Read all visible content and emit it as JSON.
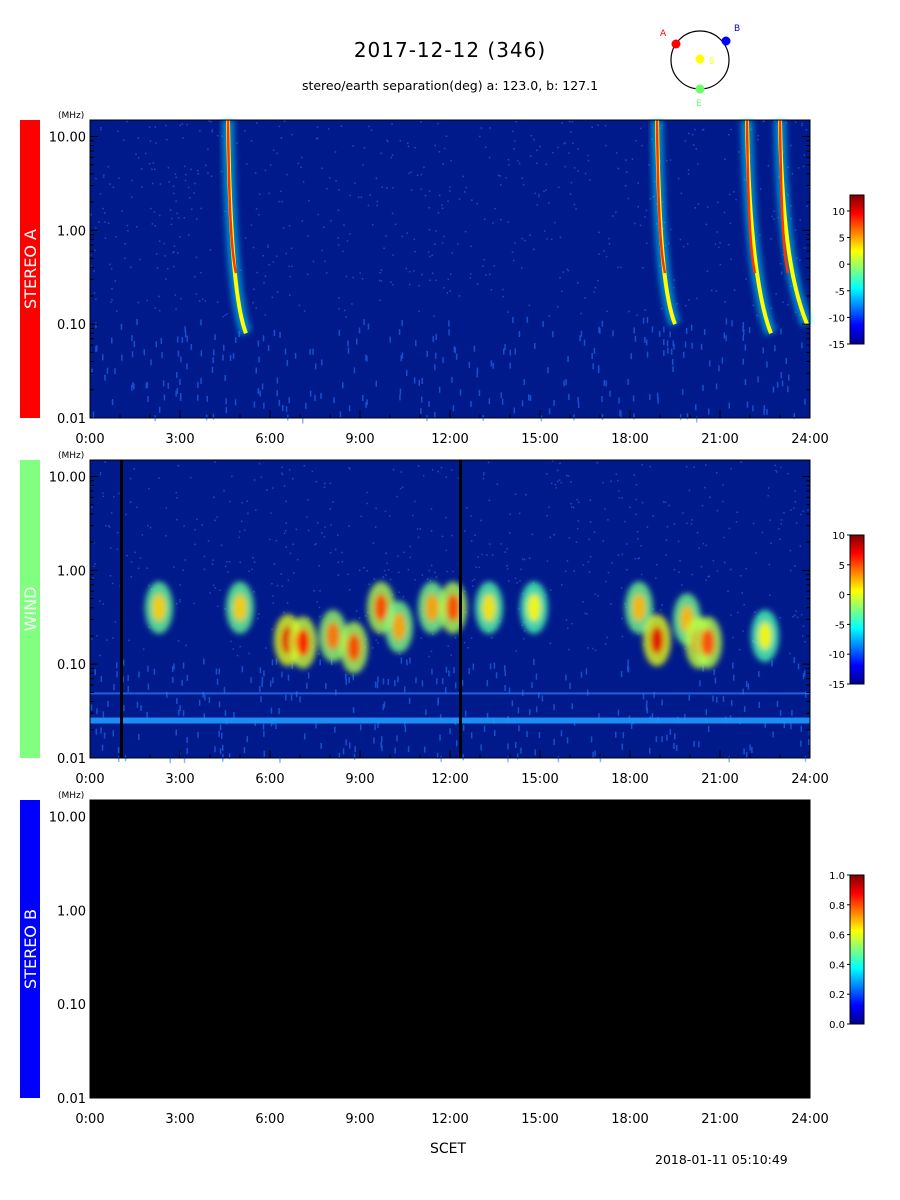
{
  "header": {
    "title": "2017-12-12 (346)",
    "subtitle": "stereo/earth separation(deg) a: 123.0, b: 127.1",
    "generated": "2018-01-11 05:10:49",
    "xaxis_title": "SCET"
  },
  "orbit": {
    "labels": {
      "a": "A",
      "b": "B",
      "sun": "S",
      "earth": "E"
    },
    "colors": {
      "a": "#ff0000",
      "b": "#0000ff",
      "sun": "#ffff00",
      "earth": "#66ff66"
    }
  },
  "colors": {
    "stereo_a": "#ff0000",
    "wind": "#80ff80",
    "stereo_b": "#0000ff",
    "background": "#001a8c",
    "empty_panel": "#000000"
  },
  "chart_data": [
    {
      "type": "heatmap",
      "label": "STEREO A",
      "yunit": "(MHz)",
      "y_scale": "log",
      "ylim": [
        0.01,
        15
      ],
      "y_ticks": [
        "10.00",
        "1.00",
        "0.10",
        "0.01"
      ],
      "y_tick_values": [
        10,
        1,
        0.1,
        0.01
      ],
      "x_ticks": [
        "0:00",
        "3:00",
        "6:00",
        "9:00",
        "12:00",
        "15:00",
        "18:00",
        "21:00",
        "24:00"
      ],
      "x_tick_values": [
        0,
        3,
        6,
        9,
        12,
        15,
        18,
        21,
        24
      ],
      "xlim": [
        0,
        24
      ],
      "colorbar": {
        "ticks": [
          "10",
          "5",
          "0",
          "-5",
          "-10",
          "-15"
        ],
        "values": [
          10,
          5,
          0,
          -5,
          -10,
          -15
        ],
        "range": [
          -15,
          13
        ]
      },
      "bursts": [
        {
          "start_hour": 4.6,
          "end_hour": 5.2,
          "f_high_mhz": 15,
          "f_low_mhz": 0.08
        },
        {
          "start_hour": 18.9,
          "end_hour": 19.5,
          "f_high_mhz": 15,
          "f_low_mhz": 0.1
        },
        {
          "start_hour": 21.9,
          "end_hour": 22.7,
          "f_high_mhz": 15,
          "f_low_mhz": 0.08
        },
        {
          "start_hour": 23.0,
          "end_hour": 23.9,
          "f_high_mhz": 15,
          "f_low_mhz": 0.1
        }
      ]
    },
    {
      "type": "heatmap",
      "label": "WIND",
      "yunit": "(MHz)",
      "y_scale": "log",
      "ylim": [
        0.01,
        15
      ],
      "y_ticks": [
        "10.00",
        "1.00",
        "0.10",
        "0.01"
      ],
      "y_tick_values": [
        10,
        1,
        0.1,
        0.01
      ],
      "x_ticks": [
        "0:00",
        "3:00",
        "6:00",
        "9:00",
        "12:00",
        "15:00",
        "18:00",
        "21:00",
        "24:00"
      ],
      "x_tick_values": [
        0,
        3,
        6,
        9,
        12,
        15,
        18,
        21,
        24
      ],
      "xlim": [
        0,
        24
      ],
      "colorbar": {
        "ticks": [
          "10",
          "5",
          "0",
          "-5",
          "-10",
          "-15"
        ],
        "values": [
          10,
          5,
          0,
          -5,
          -10,
          -15
        ],
        "range": [
          -15,
          10
        ]
      },
      "emission_patches": [
        {
          "hour": 2.3,
          "f_mhz": 0.4,
          "intensity": 0.5
        },
        {
          "hour": 5.0,
          "f_mhz": 0.4,
          "intensity": 0.5
        },
        {
          "hour": 6.6,
          "f_mhz": 0.18,
          "intensity": 1.0
        },
        {
          "hour": 7.1,
          "f_mhz": 0.17,
          "intensity": 0.9
        },
        {
          "hour": 8.1,
          "f_mhz": 0.2,
          "intensity": 0.7
        },
        {
          "hour": 8.8,
          "f_mhz": 0.15,
          "intensity": 0.8
        },
        {
          "hour": 9.7,
          "f_mhz": 0.4,
          "intensity": 0.8
        },
        {
          "hour": 10.3,
          "f_mhz": 0.25,
          "intensity": 0.6
        },
        {
          "hour": 11.4,
          "f_mhz": 0.4,
          "intensity": 0.6
        },
        {
          "hour": 12.1,
          "f_mhz": 0.4,
          "intensity": 0.8
        },
        {
          "hour": 13.3,
          "f_mhz": 0.4,
          "intensity": 0.45
        },
        {
          "hour": 14.8,
          "f_mhz": 0.4,
          "intensity": 0.4
        },
        {
          "hour": 18.3,
          "f_mhz": 0.4,
          "intensity": 0.55
        },
        {
          "hour": 18.9,
          "f_mhz": 0.18,
          "intensity": 1.0
        },
        {
          "hour": 19.9,
          "f_mhz": 0.3,
          "intensity": 0.55
        },
        {
          "hour": 20.3,
          "f_mhz": 0.17,
          "intensity": 0.85
        },
        {
          "hour": 20.6,
          "f_mhz": 0.17,
          "intensity": 0.8
        },
        {
          "hour": 22.5,
          "f_mhz": 0.2,
          "intensity": 0.4
        }
      ],
      "data_gaps_hours": [
        1.0,
        12.3
      ]
    },
    {
      "type": "heatmap",
      "label": "STEREO B",
      "yunit": "(MHz)",
      "y_scale": "log",
      "ylim": [
        0.01,
        15
      ],
      "y_ticks": [
        "10.00",
        "1.00",
        "0.10",
        "0.01"
      ],
      "y_tick_values": [
        10,
        1,
        0.1,
        0.01
      ],
      "x_ticks": [
        "0:00",
        "3:00",
        "6:00",
        "9:00",
        "12:00",
        "15:00",
        "18:00",
        "21:00",
        "24:00"
      ],
      "x_tick_values": [
        0,
        3,
        6,
        9,
        12,
        15,
        18,
        21,
        24
      ],
      "xlim": [
        0,
        24
      ],
      "no_data": true,
      "colorbar": {
        "ticks": [
          "1.0",
          "0.8",
          "0.6",
          "0.4",
          "0.2",
          "0.0"
        ],
        "values": [
          1.0,
          0.8,
          0.6,
          0.4,
          0.2,
          0.0
        ],
        "range": [
          0,
          1
        ]
      }
    }
  ]
}
